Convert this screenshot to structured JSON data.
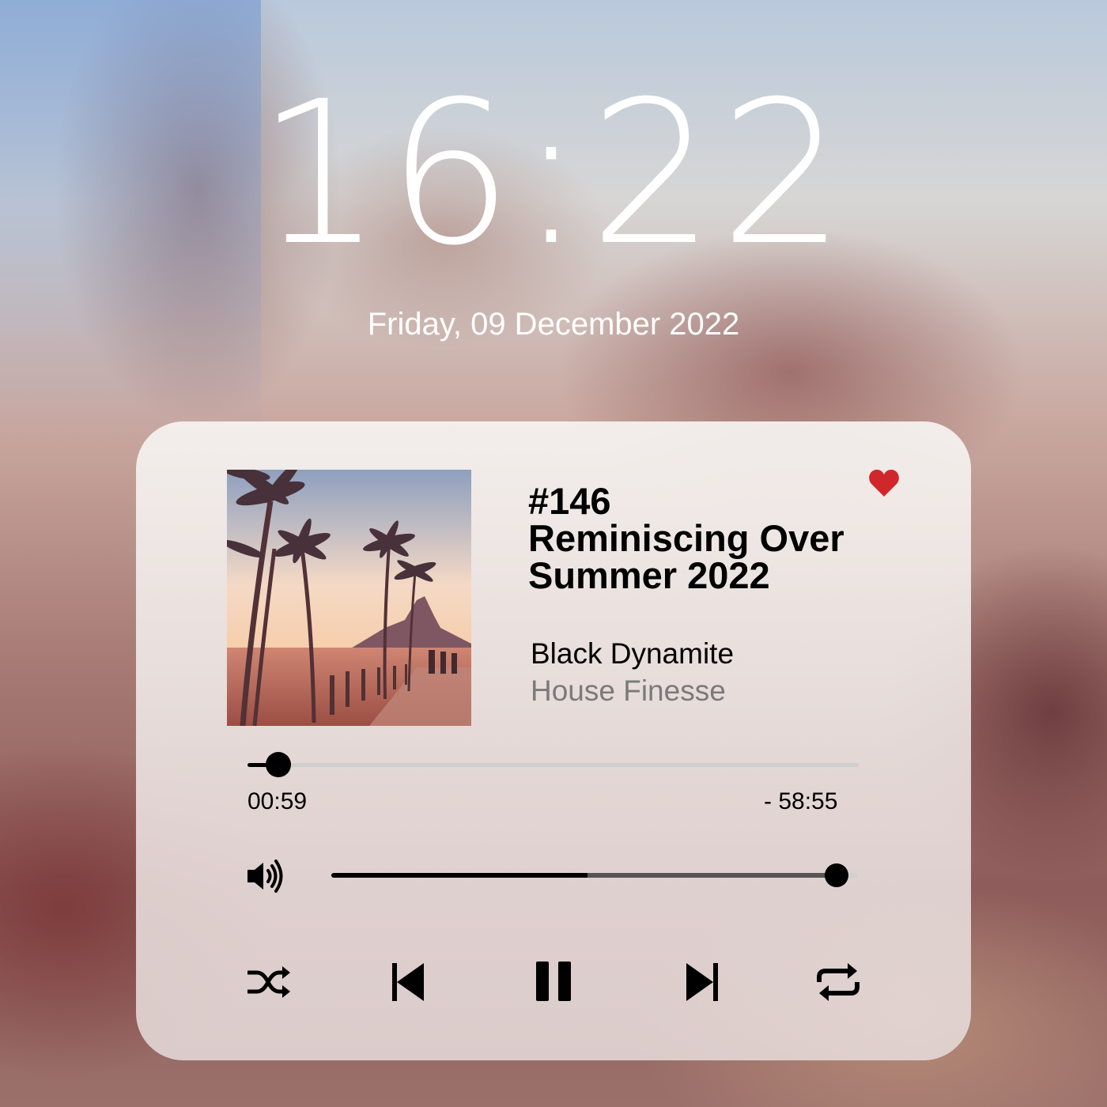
{
  "lockscreen": {
    "time": "16:22",
    "date": "Friday, 09 December 2022"
  },
  "player": {
    "episode_number": "#146",
    "title_line1": "Reminiscing Over",
    "title_line2": "Summer 2022",
    "artist": "Black Dynamite",
    "label": "House Finesse",
    "favorite": true,
    "favorite_color": "#d0282a",
    "elapsed": "00:59",
    "remaining": "- 58:55",
    "progress_fraction": 0.05,
    "volume_fraction": 0.96,
    "controls": {
      "shuffle_icon": "shuffle-icon",
      "previous_icon": "skip-previous-icon",
      "play_pause_icon": "pause-icon",
      "next_icon": "skip-next-icon",
      "repeat_icon": "repeat-icon",
      "volume_icon": "speaker-volume-icon"
    }
  }
}
